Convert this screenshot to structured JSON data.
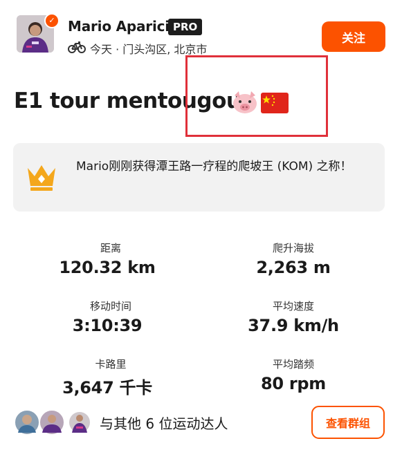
{
  "header": {
    "athlete_name": "Mario Aparicio",
    "badge": "PRO",
    "sport_icon": "bike-icon",
    "meta": "今天 · 门头沟区, 北京市",
    "follow_label": "关注"
  },
  "activity": {
    "title": "E1 tour mentougou",
    "emoji": [
      "pig-face-emoji",
      "china-flag-emoji"
    ]
  },
  "achievement": {
    "icon": "crown-icon",
    "text": "Mario刚刚获得潭王路一疗程的爬坡王 (KOM) 之称！"
  },
  "stats": [
    {
      "label": "距离",
      "value": "120.32 km"
    },
    {
      "label": "爬升海拔",
      "value": "2,263 m"
    },
    {
      "label": "移动时间",
      "value": "3:10:39"
    },
    {
      "label": "平均速度",
      "value": "37.9 km/h"
    },
    {
      "label": "卡路里",
      "value": "3,647 千卡"
    },
    {
      "label": "平均踏频",
      "value": "80 rpm"
    }
  ],
  "group": {
    "text": "与其他 6 位运动达人",
    "button_label": "查看群组"
  },
  "colors": {
    "accent": "#fc5200",
    "annotation": "#e0303a",
    "card_bg": "#f2f2f2",
    "crown": "#f4a71c"
  }
}
